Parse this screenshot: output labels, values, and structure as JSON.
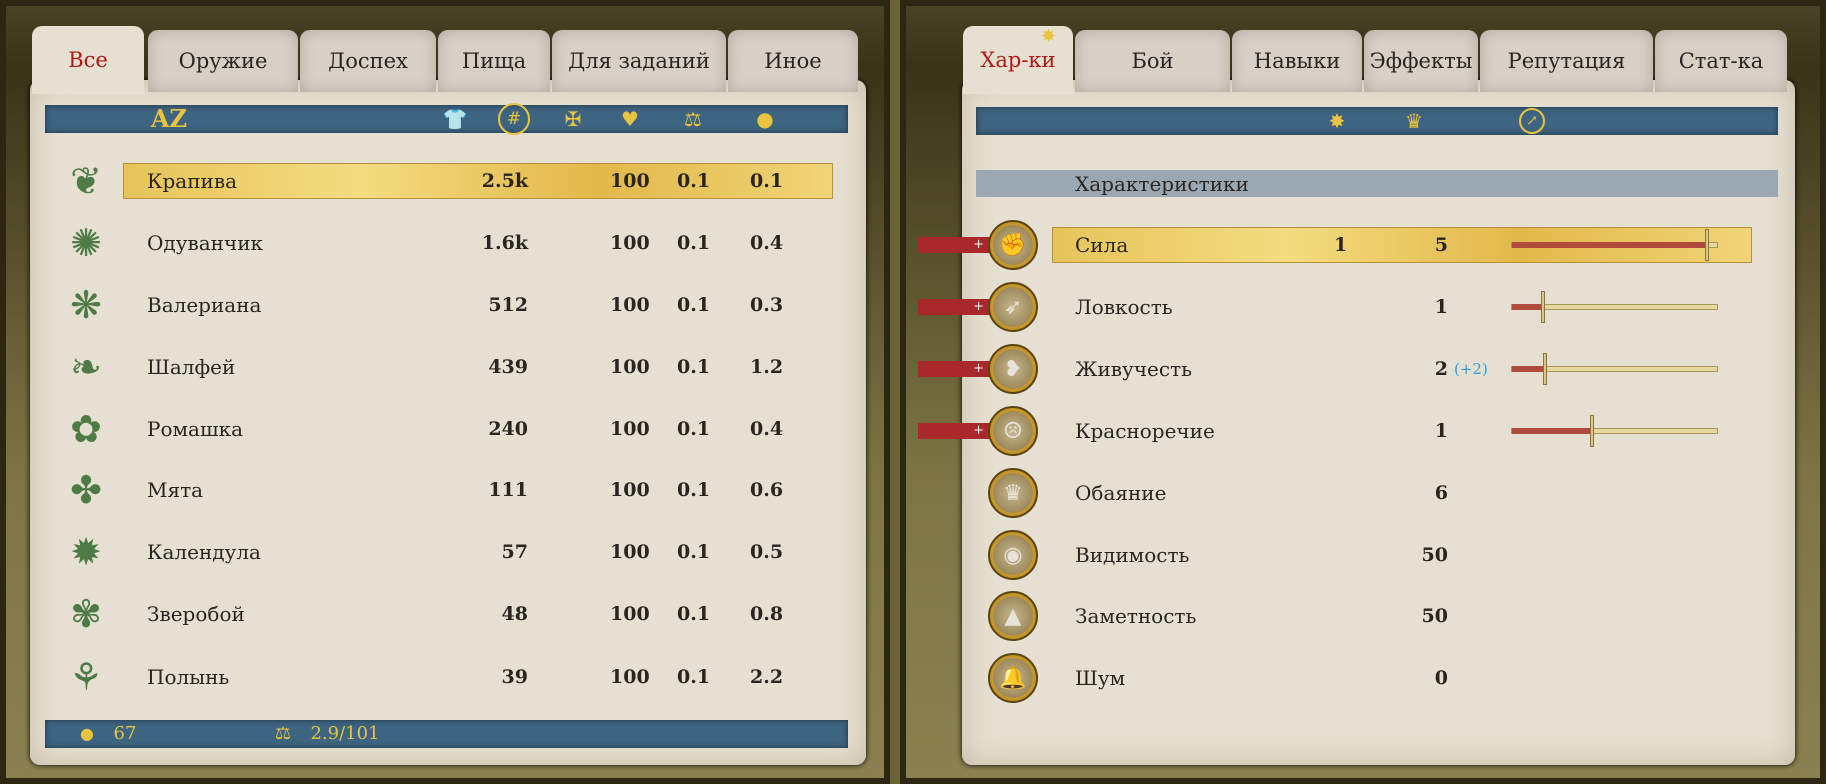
{
  "colors": {
    "accent": "#b01a14",
    "gold": "#e8c440",
    "blue_bar": "#3d6480",
    "bonus": "#2a9ee0"
  },
  "inventory": {
    "tabs": [
      {
        "label": "Все",
        "active": true
      },
      {
        "label": "Оружие"
      },
      {
        "label": "Доспех"
      },
      {
        "label": "Пища"
      },
      {
        "label": "Для заданий"
      },
      {
        "label": "Иное"
      }
    ],
    "header": {
      "sort_label": "AZ",
      "icons": [
        "shirt-icon",
        "count-sort-icon",
        "defense-cross-icon",
        "broken-heart-icon",
        "weight-scales-icon",
        "coins-icon"
      ]
    },
    "items": [
      {
        "name": "Крапива",
        "count": "2.5k",
        "condition": "100",
        "weight": "0.1",
        "price": "0.1",
        "icon": "leaf-icon",
        "selected": true
      },
      {
        "name": "Одуванчик",
        "count": "1.6k",
        "condition": "100",
        "weight": "0.1",
        "price": "0.4",
        "icon": "dandelion-icon"
      },
      {
        "name": "Валериана",
        "count": "512",
        "condition": "100",
        "weight": "0.1",
        "price": "0.3",
        "icon": "valerian-icon"
      },
      {
        "name": "Шалфей",
        "count": "439",
        "condition": "100",
        "weight": "0.1",
        "price": "1.2",
        "icon": "sage-leaf-icon"
      },
      {
        "name": "Ромашка",
        "count": "240",
        "condition": "100",
        "weight": "0.1",
        "price": "0.4",
        "icon": "chamomile-icon"
      },
      {
        "name": "Мята",
        "count": "111",
        "condition": "100",
        "weight": "0.1",
        "price": "0.6",
        "icon": "mint-icon"
      },
      {
        "name": "Календула",
        "count": "57",
        "condition": "100",
        "weight": "0.1",
        "price": "0.5",
        "icon": "calendula-icon"
      },
      {
        "name": "Зверобой",
        "count": "48",
        "condition": "100",
        "weight": "0.1",
        "price": "0.8",
        "icon": "st-johns-wort-icon"
      },
      {
        "name": "Полынь",
        "count": "39",
        "condition": "100",
        "weight": "0.1",
        "price": "2.2",
        "icon": "wormwood-icon"
      }
    ],
    "footer": {
      "money": "67",
      "weight": "2.9/101"
    }
  },
  "character": {
    "tabs": [
      {
        "label": "Хар-ки",
        "active": true
      },
      {
        "label": "Бой"
      },
      {
        "label": "Навыки"
      },
      {
        "label": "Эффекты"
      },
      {
        "label": "Репутация"
      },
      {
        "label": "Стат-ка"
      }
    ],
    "header_icons": [
      "star-icon",
      "crown-icon",
      "progress-arrow-icon"
    ],
    "section_title": "Характеристики",
    "stats": [
      {
        "name": "Сила",
        "base": "1",
        "value": "5",
        "progress": 0.95,
        "upgradable": true,
        "selected": true,
        "icon": "fist-icon"
      },
      {
        "name": "Ловкость",
        "value": "1",
        "progress": 0.15,
        "upgradable": true,
        "icon": "winged-boot-icon"
      },
      {
        "name": "Живучесть",
        "value": "2",
        "bonus": "(+2)",
        "progress": 0.16,
        "upgradable": true,
        "icon": "heart-figure-icon"
      },
      {
        "name": "Красноречие",
        "value": "1",
        "progress": 0.39,
        "upgradable": true,
        "icon": "face-icon"
      },
      {
        "name": "Обаяние",
        "value": "6",
        "icon": "crown-icon"
      },
      {
        "name": "Видимость",
        "value": "50",
        "icon": "eye-icon"
      },
      {
        "name": "Заметность",
        "value": "50",
        "icon": "hooded-head-icon"
      },
      {
        "name": "Шум",
        "value": "0",
        "icon": "bells-icon"
      }
    ]
  }
}
